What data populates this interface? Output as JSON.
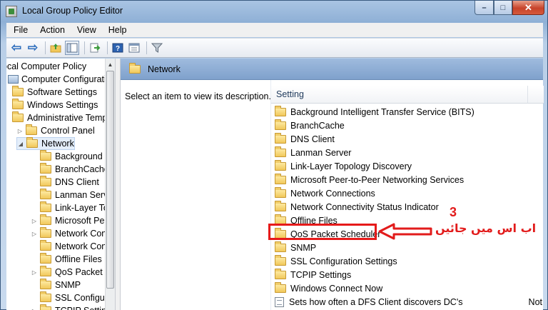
{
  "window": {
    "title": "Local Group Policy Editor"
  },
  "caption": {
    "minimize": "–",
    "maximize": "□",
    "close": "✕"
  },
  "menu": [
    "File",
    "Action",
    "View",
    "Help"
  ],
  "tree": {
    "items": [
      {
        "label": "ocal Computer Policy",
        "depth": 0,
        "icon": "computer-icon"
      },
      {
        "label": "Computer Configuration",
        "depth": 0,
        "icon": "computer-icon"
      },
      {
        "label": "Software Settings",
        "depth": 1,
        "icon": "folder-icon"
      },
      {
        "label": "Windows Settings",
        "depth": 1,
        "icon": "folder-icon"
      },
      {
        "label": "Administrative Temp",
        "depth": 1,
        "icon": "folder-icon"
      },
      {
        "label": "Control Panel",
        "depth": 2,
        "icon": "folder-icon",
        "expander": "collapsed"
      },
      {
        "label": "Network",
        "depth": 2,
        "icon": "folder-icon",
        "expander": "expanded",
        "selected": true
      },
      {
        "label": "Background I",
        "depth": 3,
        "icon": "folder-icon"
      },
      {
        "label": "BranchCache",
        "depth": 3,
        "icon": "folder-icon"
      },
      {
        "label": "DNS Client",
        "depth": 3,
        "icon": "folder-icon"
      },
      {
        "label": "Lanman Serv",
        "depth": 3,
        "icon": "folder-icon"
      },
      {
        "label": "Link-Layer To",
        "depth": 3,
        "icon": "folder-icon"
      },
      {
        "label": "Microsoft Pee",
        "depth": 3,
        "icon": "folder-icon",
        "expander": "collapsed"
      },
      {
        "label": "Network Con",
        "depth": 3,
        "icon": "folder-icon",
        "expander": "collapsed"
      },
      {
        "label": "Network Con",
        "depth": 3,
        "icon": "folder-icon"
      },
      {
        "label": "Offline Files",
        "depth": 3,
        "icon": "folder-icon"
      },
      {
        "label": "QoS Packet S",
        "depth": 3,
        "icon": "folder-icon",
        "expander": "collapsed"
      },
      {
        "label": "SNMP",
        "depth": 3,
        "icon": "folder-icon"
      },
      {
        "label": "SSL Configur",
        "depth": 3,
        "icon": "folder-icon"
      },
      {
        "label": "TCPIP Setting",
        "depth": 3,
        "icon": "folder-icon",
        "expander": "collapsed"
      }
    ]
  },
  "right": {
    "header": "Network",
    "description": "Select an item to view its description.",
    "column": "Setting",
    "rows": [
      {
        "label": "Background Intelligent Transfer Service (BITS)",
        "icon": "folder-icon"
      },
      {
        "label": "BranchCache",
        "icon": "folder-icon"
      },
      {
        "label": "DNS Client",
        "icon": "folder-icon"
      },
      {
        "label": "Lanman Server",
        "icon": "folder-icon"
      },
      {
        "label": "Link-Layer Topology Discovery",
        "icon": "folder-icon"
      },
      {
        "label": "Microsoft Peer-to-Peer Networking Services",
        "icon": "folder-icon"
      },
      {
        "label": "Network Connections",
        "icon": "folder-icon"
      },
      {
        "label": "Network Connectivity Status Indicator",
        "icon": "folder-icon"
      },
      {
        "label": "Offline Files",
        "icon": "folder-icon"
      },
      {
        "label": "QoS Packet Scheduler",
        "icon": "folder-icon",
        "highlighted": true
      },
      {
        "label": "SNMP",
        "icon": "folder-icon"
      },
      {
        "label": "SSL Configuration Settings",
        "icon": "folder-icon"
      },
      {
        "label": "TCPIP Settings",
        "icon": "folder-icon"
      },
      {
        "label": "Windows Connect Now",
        "icon": "folder-icon"
      },
      {
        "label": "Sets how often a DFS Client discovers DC's",
        "icon": "document-icon",
        "state": "Not"
      }
    ]
  },
  "annotation": {
    "number": "3",
    "text": "اب اس میں جائیں",
    "color": "#e21b1b"
  }
}
